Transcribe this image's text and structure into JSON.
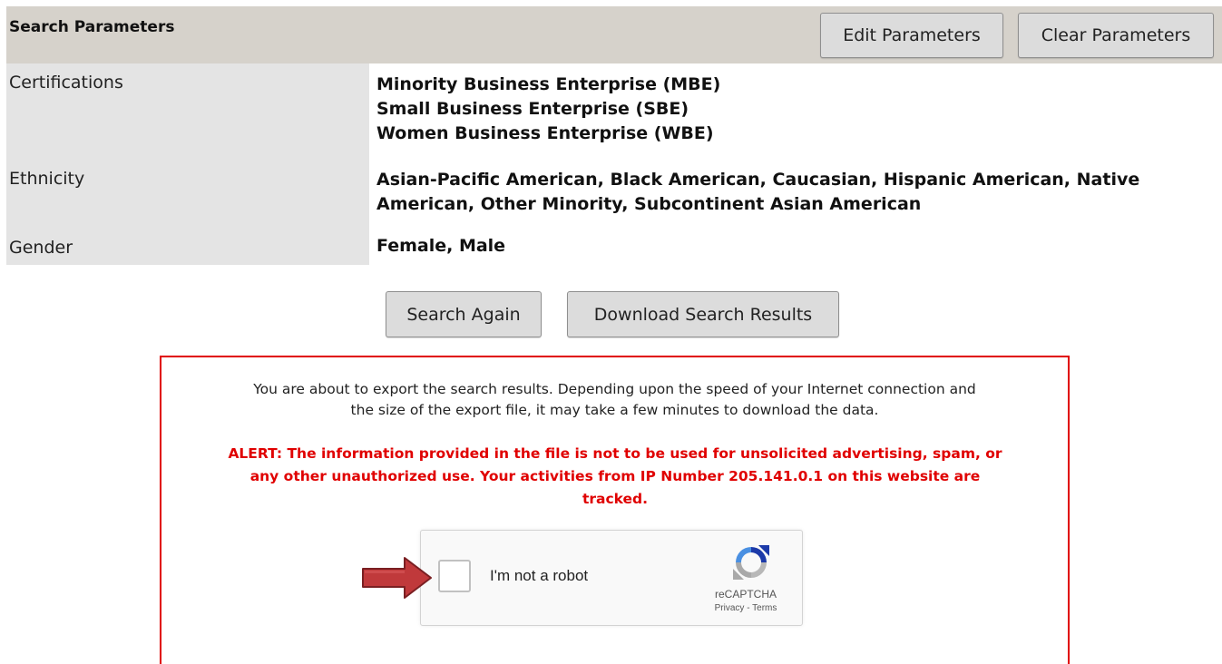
{
  "header": {
    "title": "Search Parameters",
    "edit_label": "Edit Parameters",
    "clear_label": "Clear Parameters"
  },
  "parameters": [
    {
      "label": "Certifications",
      "values": [
        "Minority Business Enterprise (MBE)",
        "Small Business Enterprise (SBE)",
        "Women Business Enterprise (WBE)"
      ]
    },
    {
      "label": "Ethnicity",
      "values": [
        "Asian-Pacific American, Black American, Caucasian, Hispanic American, Native",
        "American, Other Minority, Subcontinent Asian American"
      ]
    },
    {
      "label": "Gender",
      "values": [
        "Female, Male"
      ]
    }
  ],
  "actions": {
    "search_again_label": "Search Again",
    "download_label": "Download Search Results"
  },
  "export_notice": {
    "info_lines": [
      "You are about to export the search results. Depending upon the speed of your Internet connection and",
      "the size of the export file, it may take a few minutes to download the data."
    ],
    "alert_lines": [
      "ALERT: The information provided in the file is not to be used for unsolicited advertising, spam, or",
      "any other unauthorized use. Your activities from IP Number 205.141.0.1 on this website are",
      "tracked."
    ]
  },
  "captcha": {
    "label": "I'm not a robot",
    "brand": "reCAPTCHA",
    "privacy": "Privacy",
    "separator": " - ",
    "terms": "Terms",
    "checked": false
  },
  "colors": {
    "header_bg": "#d6d2cb",
    "label_bg": "#e4e4e4",
    "alert_red": "#e00000",
    "arrow_red": "#c0393b"
  },
  "icons": {
    "captcha_logo": "recaptcha-logo-icon",
    "pointer": "arrow-right-icon"
  }
}
